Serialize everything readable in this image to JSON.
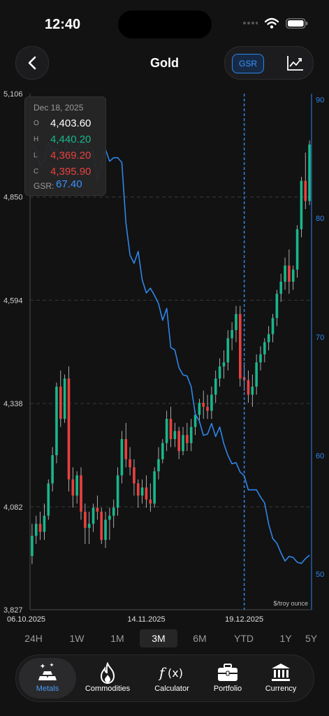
{
  "status_bar": {
    "time": "12:40"
  },
  "nav": {
    "title": "Gold",
    "gsr_label": "GSR"
  },
  "tooltip": {
    "date": "Dec 18, 2025",
    "o_label": "O",
    "o": "4,403.60",
    "h_label": "H",
    "h": "4,440.20",
    "l_label": "L",
    "l": "4,369.20",
    "c_label": "C",
    "c": "4,395.90",
    "gsr_label": "GSR:",
    "gsr": "67.40"
  },
  "colors": {
    "up": "#19b68a",
    "down": "#e8413f",
    "gsr_line": "#2f86e8",
    "background": "#121212"
  },
  "chart_data": {
    "type": "candlestick",
    "unit_label": "$/troy ounce",
    "y_left": {
      "ticks": [
        "5,106",
        "4,850",
        "4,594",
        "4,338",
        "4,082",
        "3,827"
      ],
      "range": [
        3827,
        5106
      ]
    },
    "y_right": {
      "ticks": [
        "90",
        "80",
        "70",
        "60",
        "50"
      ],
      "range": [
        47,
        90.5
      ]
    },
    "x_ticks": [
      "06.10.2025",
      "14.11.2025",
      "19.12.2025"
    ],
    "x_tick_index": [
      0,
      28,
      52
    ],
    "crosshair_index": 52,
    "series": [
      {
        "name": "Gold",
        "values": [
          [
            3960,
            4040,
            3940,
            4010
          ],
          [
            4010,
            4060,
            3990,
            4040
          ],
          [
            4040,
            4070,
            4000,
            4020
          ],
          [
            4020,
            4090,
            4000,
            4060
          ],
          [
            4060,
            4150,
            4050,
            4140
          ],
          [
            4140,
            4230,
            4120,
            4210
          ],
          [
            4210,
            4390,
            4190,
            4380
          ],
          [
            4380,
            4420,
            4280,
            4300
          ],
          [
            4300,
            4410,
            4290,
            4400
          ],
          [
            4400,
            4430,
            4120,
            4150
          ],
          [
            4150,
            4180,
            4080,
            4110
          ],
          [
            4110,
            4170,
            4090,
            4160
          ],
          [
            4160,
            4180,
            4050,
            4070
          ],
          [
            4070,
            4090,
            3990,
            4030
          ],
          [
            4030,
            4070,
            3990,
            4040
          ],
          [
            4040,
            4090,
            4020,
            4080
          ],
          [
            4080,
            4110,
            4050,
            4070
          ],
          [
            4070,
            4080,
            3990,
            4000
          ],
          [
            4000,
            4070,
            3980,
            4050
          ],
          [
            4050,
            4080,
            4000,
            4060
          ],
          [
            4060,
            4100,
            4030,
            4080
          ],
          [
            4080,
            4180,
            4060,
            4160
          ],
          [
            4160,
            4270,
            4140,
            4250
          ],
          [
            4250,
            4290,
            4180,
            4200
          ],
          [
            4200,
            4230,
            4160,
            4180
          ],
          [
            4180,
            4200,
            4110,
            4140
          ],
          [
            4140,
            4150,
            4080,
            4110
          ],
          [
            4110,
            4150,
            4090,
            4130
          ],
          [
            4130,
            4160,
            4080,
            4100
          ],
          [
            4100,
            4140,
            4070,
            4090
          ],
          [
            4090,
            4180,
            4080,
            4170
          ],
          [
            4170,
            4230,
            4150,
            4200
          ],
          [
            4200,
            4250,
            4190,
            4240
          ],
          [
            4240,
            4320,
            4220,
            4300
          ],
          [
            4300,
            4330,
            4230,
            4250
          ],
          [
            4250,
            4290,
            4230,
            4270
          ],
          [
            4270,
            4280,
            4200,
            4220
          ],
          [
            4220,
            4280,
            4210,
            4260
          ],
          [
            4260,
            4290,
            4220,
            4240
          ],
          [
            4240,
            4300,
            4220,
            4280
          ],
          [
            4280,
            4320,
            4260,
            4310
          ],
          [
            4310,
            4350,
            4290,
            4340
          ],
          [
            4340,
            4370,
            4300,
            4330
          ],
          [
            4330,
            4360,
            4300,
            4320
          ],
          [
            4320,
            4380,
            4300,
            4360
          ],
          [
            4360,
            4420,
            4340,
            4400
          ],
          [
            4400,
            4450,
            4380,
            4430
          ],
          [
            4430,
            4470,
            4400,
            4440
          ],
          [
            4440,
            4520,
            4420,
            4500
          ],
          [
            4500,
            4540,
            4470,
            4520
          ],
          [
            4520,
            4580,
            4490,
            4560
          ],
          [
            4560,
            4580,
            4380,
            4400
          ],
          [
            4403.6,
            4440.2,
            4369.2,
            4395.9
          ],
          [
            4396,
            4420,
            4340,
            4360
          ],
          [
            4360,
            4410,
            4330,
            4380
          ],
          [
            4380,
            4460,
            4360,
            4440
          ],
          [
            4440,
            4480,
            4420,
            4460
          ],
          [
            4460,
            4500,
            4440,
            4490
          ],
          [
            4490,
            4530,
            4470,
            4510
          ],
          [
            4510,
            4560,
            4490,
            4550
          ],
          [
            4550,
            4620,
            4530,
            4610
          ],
          [
            4610,
            4660,
            4590,
            4640
          ],
          [
            4640,
            4700,
            4620,
            4680
          ],
          [
            4680,
            4720,
            4610,
            4640
          ],
          [
            4640,
            4680,
            4620,
            4670
          ],
          [
            4670,
            4780,
            4650,
            4770
          ],
          [
            4770,
            4900,
            4750,
            4890
          ],
          [
            4890,
            4960,
            4820,
            4840
          ],
          [
            4840,
            4990,
            4830,
            4980
          ]
        ]
      },
      {
        "name": "GSR",
        "values": [
          86.1,
          85.8,
          84.4,
          84.9,
          86.4,
          85.7,
          85.9,
          85.3,
          85.6,
          86.8,
          86.0,
          85.8,
          86.3,
          86.3,
          85.1,
          85.7,
          83.2,
          84.8,
          85.8,
          84.8,
          85.1,
          85.1,
          84.7,
          79.6,
          76.9,
          76.2,
          77.2,
          74.8,
          73.7,
          74.1,
          73.5,
          72.8,
          71.4,
          72.4,
          69.1,
          68.9,
          67.4,
          66.8,
          66.7,
          65.8,
          63.5,
          62.9,
          61.7,
          61.8,
          62.7,
          61.6,
          62.4,
          61.0,
          60.0,
          59.3,
          59.4,
          58.6,
          58.3,
          57.1,
          57.1,
          57.1,
          56.5,
          56.0,
          54.2,
          53.0,
          52.6,
          51.8,
          51.1,
          51.5,
          51.4,
          51.0,
          50.9,
          51.3,
          51.6
        ]
      }
    ]
  },
  "ranges": [
    "24H",
    "1W",
    "1M",
    "3M",
    "6M",
    "YTD",
    "1Y",
    "5Y"
  ],
  "active_range_index": 3,
  "tabs": [
    {
      "label": "Metals",
      "icon": "gold-bars-icon"
    },
    {
      "label": "Commodities",
      "icon": "flame-icon"
    },
    {
      "label": "Calculator",
      "icon": "function-icon"
    },
    {
      "label": "Portfolio",
      "icon": "briefcase-icon"
    },
    {
      "label": "Currency",
      "icon": "bank-icon"
    }
  ],
  "active_tab_index": 0
}
